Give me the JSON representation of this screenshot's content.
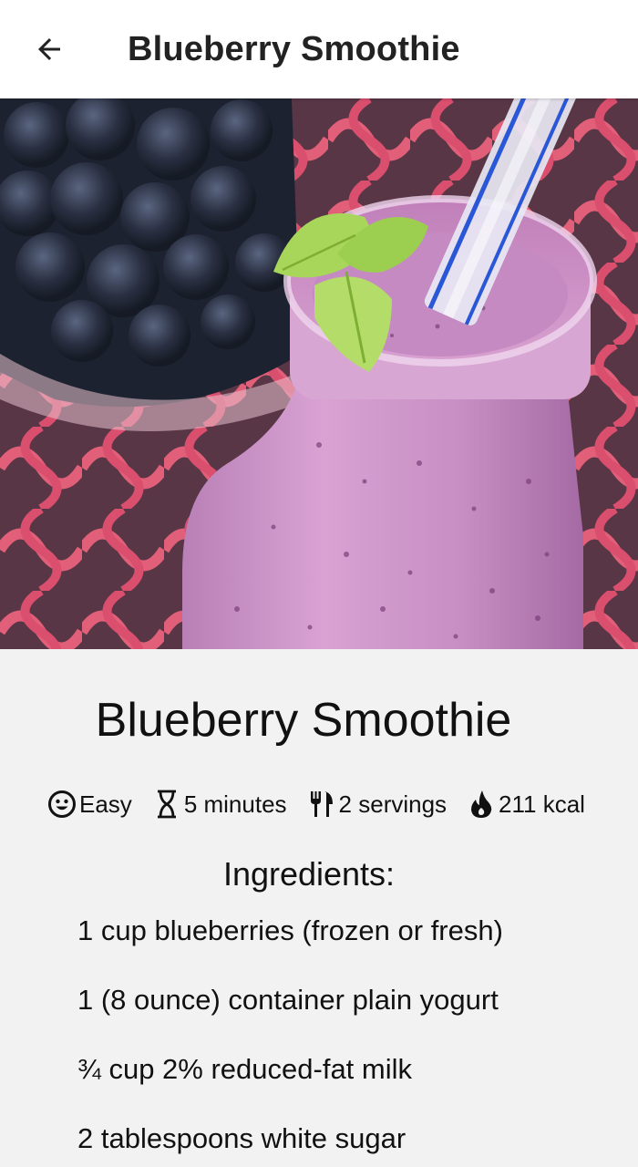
{
  "appbar": {
    "title": "Blueberry Smoothie",
    "back_icon": "arrow-left-icon"
  },
  "hero": {
    "image_description_icon": "smoothie-photo"
  },
  "recipe": {
    "title": "Blueberry Smoothie",
    "meta": [
      {
        "icon": "smiley-icon",
        "text": "Easy"
      },
      {
        "icon": "hourglass-icon",
        "text": "5 minutes"
      },
      {
        "icon": "fork-knife-icon",
        "text": "2 servings"
      },
      {
        "icon": "flame-icon",
        "text": "211 kcal"
      }
    ],
    "ingredients_heading": "Ingredients:",
    "ingredients": [
      "1 cup blueberries (frozen or fresh)",
      "1 (8 ounce) container plain yogurt",
      "¾ cup 2% reduced-fat milk",
      "2 tablespoons white sugar"
    ]
  },
  "colors": {
    "appbar_bg": "#ffffff",
    "content_bg": "#f2f2f2",
    "smoothie": "#c98bc2",
    "mint": "#a7d65a",
    "cloth": "#e0506a"
  }
}
